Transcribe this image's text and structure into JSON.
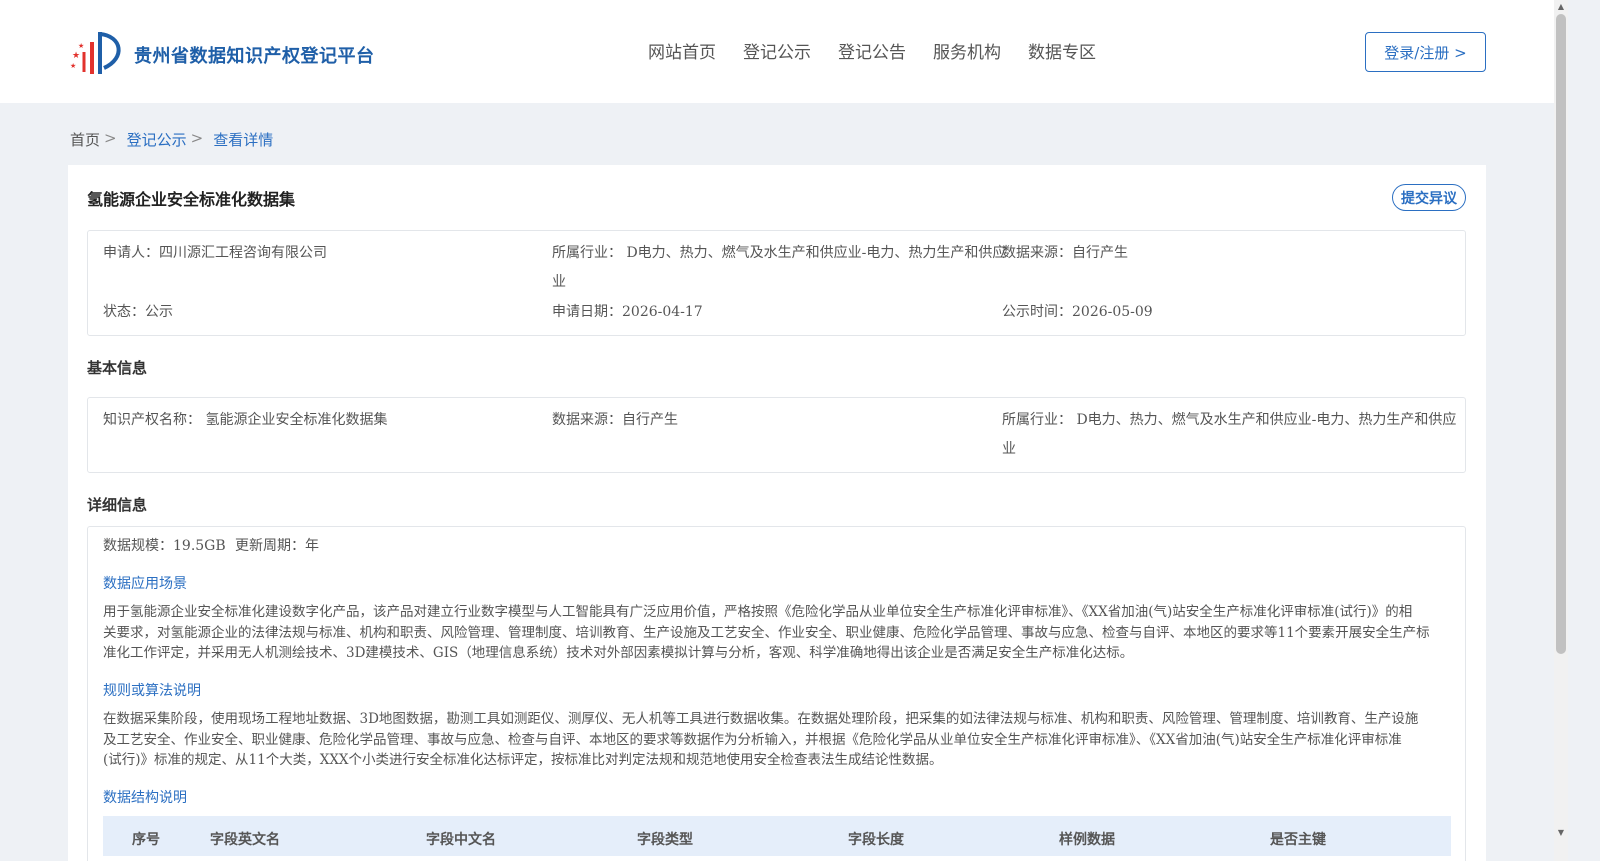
{
  "header": {
    "logo_text": "贵州省数据知识产权登记平台",
    "nav": [
      "网站首页",
      "登记公示",
      "登记公告",
      "服务机构",
      "数据专区"
    ],
    "login_label": "登录/注册 >"
  },
  "breadcrumb": {
    "home": "首页",
    "sep": ">",
    "level1": "登记公示",
    "current": "查看详情"
  },
  "detail": {
    "title": "氢能源企业安全标准化数据集",
    "objection_label": "提交异议",
    "summary": {
      "applicant": "申请人：四川源汇工程咨询有限公司",
      "industry_line1": "所属行业： D电力、热力、燃气及水生产和供应业-电力、热力生产和供应",
      "industry_line2": "业",
      "source": "数据来源：自行产生",
      "status": "状态：公示",
      "apply_date": "申请日期：2026-04-17",
      "publish_date": "公示时间：2026-05-09"
    },
    "basic": {
      "section_title": "基本信息",
      "ip_name": "知识产权名称： 氢能源企业安全标准化数据集",
      "source": "数据来源：自行产生",
      "industry_line1": "所属行业： D电力、热力、燃气及水生产和供应业-电力、热力生产和供应",
      "industry_line2": "业"
    },
    "details": {
      "section_title": "详细信息",
      "scale": "数据规模：19.5GB",
      "cycle": "更新周期：年",
      "scenario_title": "数据应用场景",
      "scenario_lines": [
        "用于氢能源企业安全标准化建设数字化产品，该产品对建立行业数字模型与人工智能具有广泛应用价值，严格按照《危险化学品从业单位安全生产标准化评审标准》、《XX省加油(气)站安全生产标准化评审标准(试行)》的相",
        "关要求，对氢能源企业的法律法规与标准、机构和职责、风险管理、管理制度、培训教育、生产设施及工艺安全、作业安全、职业健康、危险化学品管理、事故与应急、检查与自评、本地区的要求等11个要素开展安全生产标",
        "准化工作评定，并采用无人机测绘技术、3D建模技术、GIS（地理信息系统）技术对外部因素模拟计算与分析，客观、科学准确地得出该企业是否满足安全生产标准化达标。"
      ],
      "algorithm_title": "规则或算法说明",
      "algorithm_lines": [
        "在数据采集阶段，使用现场工程地址数据、3D地图数据，勘测工具如测距仪、测厚仪、无人机等工具进行数据收集。在数据处理阶段，把采集的如法律法规与标准、机构和职责、风险管理、管理制度、培训教育、生产设施",
        "及工艺安全、作业安全、职业健康、危险化学品管理、事故与应急、检查与自评、本地区的要求等数据作为分析输入，并根据《危险化学品从业单位安全生产标准化评审标准》、《XX省加油(气)站安全生产标准化评审标准",
        "(试行)》标准的规定、从11个大类，XXX个小类进行安全标准化达标评定，按标准比对判定法规和规范地使用安全检查表法生成结论性数据。"
      ],
      "structure_title": "数据结构说明",
      "table_headers": [
        "序号",
        "字段英文名",
        "字段中文名",
        "字段类型",
        "字段长度",
        "样例数据",
        "是否主键"
      ]
    }
  }
}
